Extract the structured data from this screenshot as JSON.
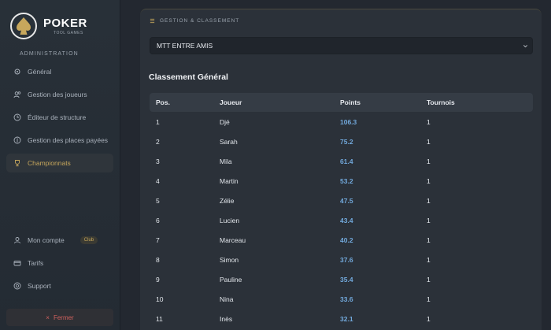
{
  "brand": {
    "title": "POKER",
    "subtitle": "TOOL GAMES",
    "admin": "ADMINISTRATION"
  },
  "nav": {
    "general": "Général",
    "players": "Gestion des joueurs",
    "structure": "Éditeur de structure",
    "paid": "Gestion des places payées",
    "championships": "Championnats",
    "account": "Mon compte",
    "account_badge": "Club",
    "pricing": "Tarifs",
    "support": "Support",
    "logout": "Fermer"
  },
  "panel": {
    "header": "GESTION & CLASSEMENT",
    "select_value": "MTT ENTRE AMIS",
    "section_title": "Classement Général"
  },
  "table": {
    "headers": [
      "Pos.",
      "Joueur",
      "Points",
      "Tournois"
    ],
    "rows": [
      [
        "1",
        "Djé",
        "106.3",
        "1"
      ],
      [
        "2",
        "Sarah",
        "75.2",
        "1"
      ],
      [
        "3",
        "Mila",
        "61.4",
        "1"
      ],
      [
        "4",
        "Martin",
        "53.2",
        "1"
      ],
      [
        "5",
        "Zélie",
        "47.5",
        "1"
      ],
      [
        "6",
        "Lucien",
        "43.4",
        "1"
      ],
      [
        "7",
        "Marceau",
        "40.2",
        "1"
      ],
      [
        "8",
        "Simon",
        "37.6",
        "1"
      ],
      [
        "9",
        "Pauline",
        "35.4",
        "1"
      ],
      [
        "10",
        "Nina",
        "33.6",
        "1"
      ],
      [
        "11",
        "Inès",
        "32.1",
        "1"
      ]
    ]
  },
  "colors": {
    "accent": "#c7a75c",
    "points": "#72a9dc",
    "danger": "#d0615e"
  }
}
